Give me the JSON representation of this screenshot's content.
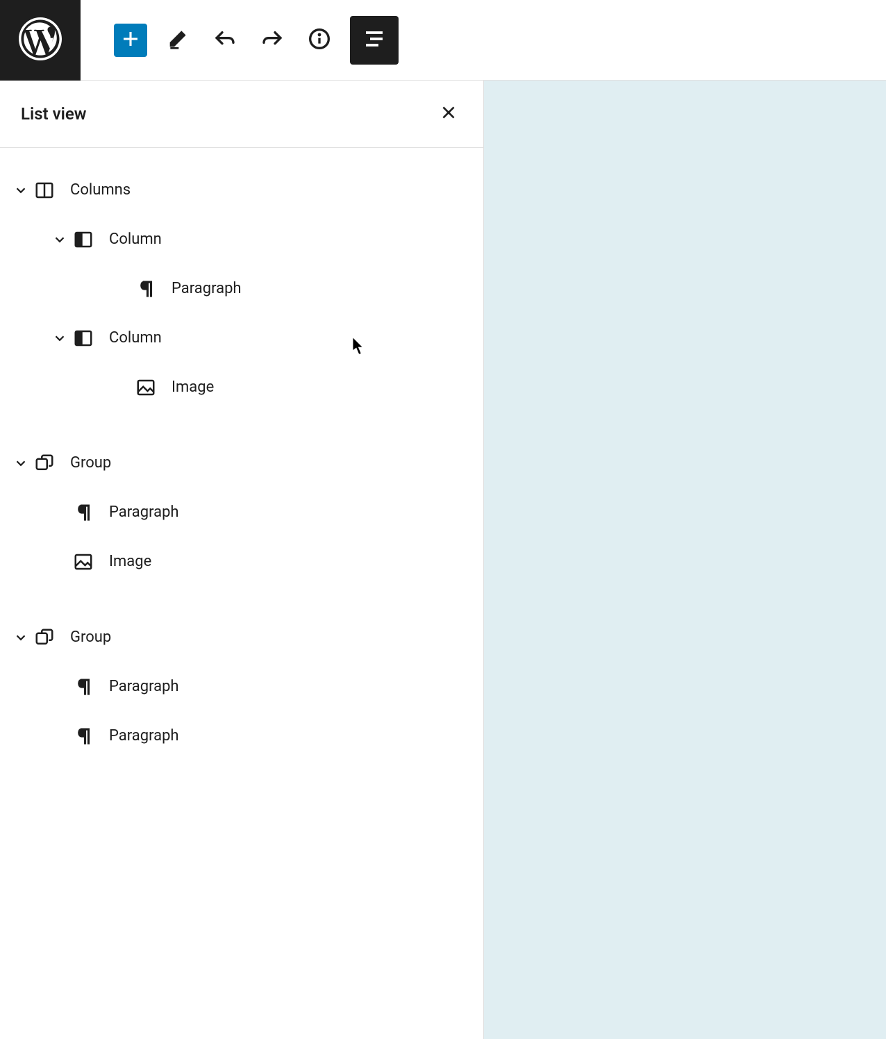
{
  "sidebar": {
    "title": "List view"
  },
  "tree": [
    {
      "label": "Columns",
      "icon": "columns",
      "expanded": true,
      "children": [
        {
          "label": "Column",
          "icon": "column",
          "expanded": true,
          "children": [
            {
              "label": "Paragraph",
              "icon": "paragraph"
            }
          ]
        },
        {
          "label": "Column",
          "icon": "column",
          "expanded": true,
          "children": [
            {
              "label": "Image",
              "icon": "image"
            }
          ]
        }
      ]
    },
    {
      "label": "Group",
      "icon": "group",
      "expanded": true,
      "children": [
        {
          "label": "Paragraph",
          "icon": "paragraph"
        },
        {
          "label": "Image",
          "icon": "image"
        }
      ]
    },
    {
      "label": "Group",
      "icon": "group",
      "expanded": true,
      "children": [
        {
          "label": "Paragraph",
          "icon": "paragraph"
        },
        {
          "label": "Paragraph",
          "icon": "paragraph"
        }
      ]
    }
  ]
}
